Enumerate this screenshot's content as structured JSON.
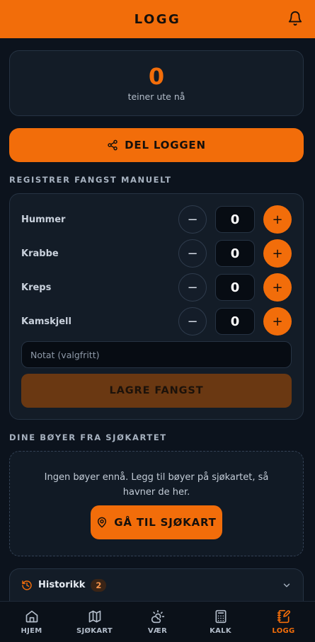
{
  "header": {
    "title": "LOGG"
  },
  "counter": {
    "value": "0",
    "label": "teiner ute nå"
  },
  "share_button": {
    "label": "DEL LOGGEN"
  },
  "manual": {
    "section_title": "REGISTRER FANGST MANUELT",
    "rows": [
      {
        "label": "Hummer",
        "qty": "0",
        "minus": "−",
        "plus": "+"
      },
      {
        "label": "Krabbe",
        "qty": "0",
        "minus": "−",
        "plus": "+"
      },
      {
        "label": "Kreps",
        "qty": "0",
        "minus": "−",
        "plus": "+"
      },
      {
        "label": "Kamskjell",
        "qty": "0",
        "minus": "−",
        "plus": "+"
      }
    ],
    "note_placeholder": "Notat (valgfritt)",
    "save_label": "LAGRE FANGST"
  },
  "buoys": {
    "section_title": "DINE BØYER FRA SJØKARTET",
    "empty_text": "Ingen bøyer ennå. Legg til bøyer på sjøkartet, så havner de her.",
    "map_button": "GÅ TIL SJØKART"
  },
  "history": {
    "label": "Historikk",
    "count": "2"
  },
  "nav": {
    "items": [
      {
        "label": "HJEM",
        "icon": "home-icon"
      },
      {
        "label": "SJØKART",
        "icon": "map-icon"
      },
      {
        "label": "VÆR",
        "icon": "weather-icon"
      },
      {
        "label": "KALK",
        "icon": "calculator-icon"
      },
      {
        "label": "LOGG",
        "icon": "log-icon",
        "active": true
      }
    ]
  },
  "colors": {
    "accent": "#f26d0a",
    "background": "#0c131d",
    "card": "#131c27"
  }
}
